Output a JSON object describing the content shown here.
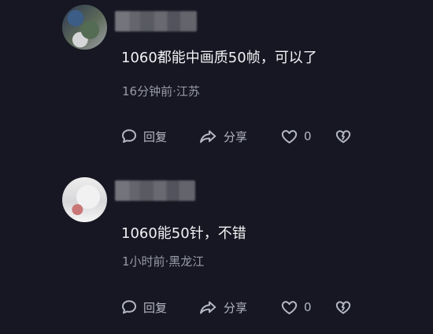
{
  "comments": [
    {
      "text": "1060都能中画质50帧，可以了",
      "meta": "16分钟前·江苏",
      "actions": {
        "reply_label": "回复",
        "share_label": "分享",
        "like_count": "0"
      }
    },
    {
      "text": "1060能50针，不错",
      "meta": "1小时前·黑龙江",
      "actions": {
        "reply_label": "回复",
        "share_label": "分享",
        "like_count": "0"
      }
    }
  ],
  "icons": {
    "reply": "comment-icon",
    "share": "share-arrow-icon",
    "like": "heart-icon",
    "dislike": "broken-heart-icon"
  },
  "colors": {
    "background": "#161722",
    "text": "#f2f2f5",
    "muted_text": "#989aa6",
    "icon": "#b5b7c3"
  }
}
